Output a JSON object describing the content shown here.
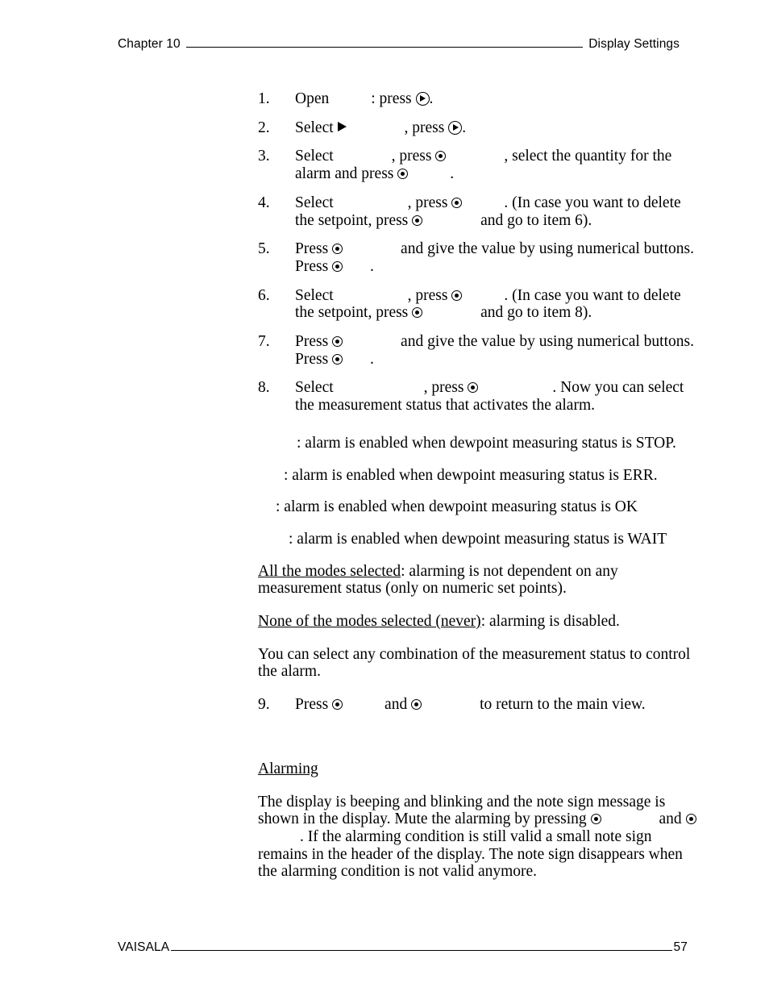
{
  "header": {
    "left": "Chapter 10",
    "right": "Display Settings"
  },
  "footer": {
    "left": "VAISALA",
    "page_number": "57"
  },
  "icons": {
    "circle_arrow": "circled-right-arrow-key-icon",
    "dot_circle": "soft-key-icon",
    "triangle_right": "right-triangle-marker-icon"
  },
  "steps": [
    {
      "number": "1.",
      "parts": [
        {
          "type": "text",
          "value": "Open"
        },
        {
          "type": "gap",
          "size": "g-md"
        },
        {
          "type": "text",
          "value": ": press "
        },
        {
          "type": "icon",
          "value": "circle-arrow"
        },
        {
          "type": "text",
          "value": "."
        }
      ]
    },
    {
      "number": "2.",
      "parts": [
        {
          "type": "text",
          "value": "Select "
        },
        {
          "type": "icon",
          "value": "triangle-right"
        },
        {
          "type": "gap",
          "size": "g-lg"
        },
        {
          "type": "text",
          "value": ", press "
        },
        {
          "type": "icon",
          "value": "circle-arrow"
        },
        {
          "type": "text",
          "value": "."
        }
      ]
    },
    {
      "number": "3.",
      "parts": [
        {
          "type": "text",
          "value": "Select"
        },
        {
          "type": "gap",
          "size": "g-lg"
        },
        {
          "type": "text",
          "value": ", press "
        },
        {
          "type": "icon",
          "value": "dot-circle"
        },
        {
          "type": "gap",
          "size": "g-lg"
        },
        {
          "type": "text",
          "value": ", select the quantity for the alarm and press "
        },
        {
          "type": "icon",
          "value": "dot-circle"
        },
        {
          "type": "gap",
          "size": "g-md"
        },
        {
          "type": "text",
          "value": "."
        }
      ]
    },
    {
      "number": "4.",
      "parts": [
        {
          "type": "text",
          "value": "Select"
        },
        {
          "type": "gap",
          "size": "g-xl"
        },
        {
          "type": "text",
          "value": ", press "
        },
        {
          "type": "icon",
          "value": "dot-circle"
        },
        {
          "type": "gap",
          "size": "g-md"
        },
        {
          "type": "text",
          "value": ". (In case you want to delete the setpoint, press "
        },
        {
          "type": "icon",
          "value": "dot-circle"
        },
        {
          "type": "gap",
          "size": "g-lg"
        },
        {
          "type": "text",
          "value": "and go to item 6)."
        }
      ]
    },
    {
      "number": "5.",
      "parts": [
        {
          "type": "text",
          "value": "Press "
        },
        {
          "type": "icon",
          "value": "dot-circle"
        },
        {
          "type": "gap",
          "size": "g-lg"
        },
        {
          "type": "text",
          "value": "and give the value by using numerical buttons. Press "
        },
        {
          "type": "icon",
          "value": "dot-circle"
        },
        {
          "type": "gap",
          "size": "g-sm"
        },
        {
          "type": "text",
          "value": "."
        }
      ]
    },
    {
      "number": "6.",
      "parts": [
        {
          "type": "text",
          "value": "Select"
        },
        {
          "type": "gap",
          "size": "g-xl"
        },
        {
          "type": "text",
          "value": ", press "
        },
        {
          "type": "icon",
          "value": "dot-circle"
        },
        {
          "type": "gap",
          "size": "g-md"
        },
        {
          "type": "text",
          "value": ". (In case you want to delete the setpoint, press "
        },
        {
          "type": "icon",
          "value": "dot-circle"
        },
        {
          "type": "gap",
          "size": "g-lg"
        },
        {
          "type": "text",
          "value": "and go to item 8)."
        }
      ]
    },
    {
      "number": "7.",
      "parts": [
        {
          "type": "text",
          "value": "Press "
        },
        {
          "type": "icon",
          "value": "dot-circle"
        },
        {
          "type": "gap",
          "size": "g-lg"
        },
        {
          "type": "text",
          "value": "and give the value by using numerical buttons. Press "
        },
        {
          "type": "icon",
          "value": "dot-circle"
        },
        {
          "type": "gap",
          "size": "g-sm"
        },
        {
          "type": "text",
          "value": "."
        }
      ]
    },
    {
      "number": "8.",
      "parts": [
        {
          "type": "text",
          "value": "Select"
        },
        {
          "type": "gap",
          "size": "g-xxl"
        },
        {
          "type": "text",
          "value": ", press "
        },
        {
          "type": "icon",
          "value": "dot-circle"
        },
        {
          "type": "gap",
          "size": "g-xl"
        },
        {
          "type": "text",
          "value": ". Now you can select the measurement status that activates the alarm."
        }
      ]
    }
  ],
  "status_lines": [
    ": alarm is enabled when dewpoint measuring status is STOP.",
    ": alarm is enabled when dewpoint measuring status is ERR.",
    ": alarm is enabled when dewpoint measuring status is OK",
    ": alarm is enabled when dewpoint measuring status is WAIT"
  ],
  "paragraphs": {
    "all_modes_label": "All the modes selected",
    "all_modes_rest": ": alarming is not dependent on any measurement status (only on numeric set points).",
    "none_modes_label": "None of the modes selected (never)",
    "none_modes_rest": ": alarming is disabled.",
    "combination": "You can select any combination of the measurement status to control the alarm."
  },
  "step9": {
    "number": "9.",
    "press_label": "Press ",
    "and_label": "and ",
    "tail": "to return to the main view."
  },
  "alarming": {
    "heading": "Alarming",
    "text_1": "The display is beeping and blinking and the note sign message is shown in the display. Mute the alarming by pressing ",
    "text_2": "and ",
    "text_3": ". If the alarming condition is still valid a small note sign remains in the header of the display. The note sign disappears when the alarming condition is not valid anymore."
  }
}
